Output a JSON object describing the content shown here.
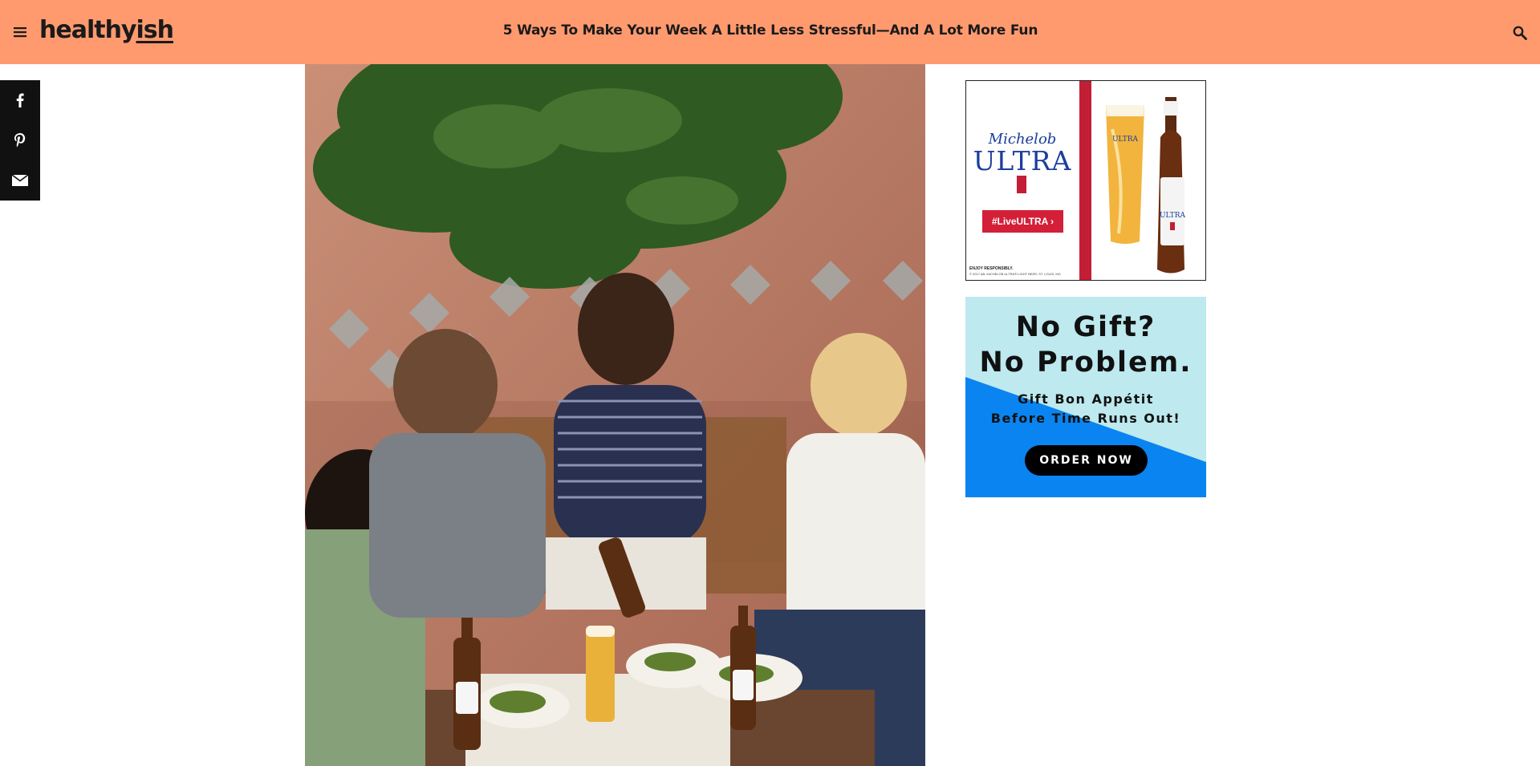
{
  "header": {
    "logo_main": "healthy",
    "logo_accent": "ish",
    "headline": "5 Ways To Make Your Week A Little Less Stressful—And A Lot More Fun",
    "menu_icon": "menu-icon",
    "search_icon": "search-icon",
    "bar_color": "#ff9a6f"
  },
  "share": {
    "items": [
      {
        "name": "facebook",
        "icon": "facebook-icon",
        "glyph": "f"
      },
      {
        "name": "pinterest",
        "icon": "pinterest-icon",
        "glyph": "P"
      },
      {
        "name": "email",
        "icon": "email-icon",
        "glyph": "✉"
      }
    ]
  },
  "hero_image": {
    "subject": "Friends sharing a meal with beer outdoors"
  },
  "ads": {
    "michelob": {
      "brand_script": "Michelob",
      "brand_name": "ULTRA",
      "cta": "#LiveULTRA ›",
      "fine_print_1": "ENJOY RESPONSIBLY.",
      "fine_print_2": "© 2017 AB, MICHELOB ULTRA® LIGHT BEER, ST. LOUIS, MO",
      "accent_color": "#c21f36"
    },
    "bon_appetit": {
      "headline_1": "No Gift?",
      "headline_2": "No Problem.",
      "sub_1": "Gift Bon Appétit",
      "sub_2": "Before Time Runs Out!",
      "cta": "ORDER NOW",
      "bg_light": "#bde9ef",
      "bg_blue": "#0a84f0"
    }
  }
}
